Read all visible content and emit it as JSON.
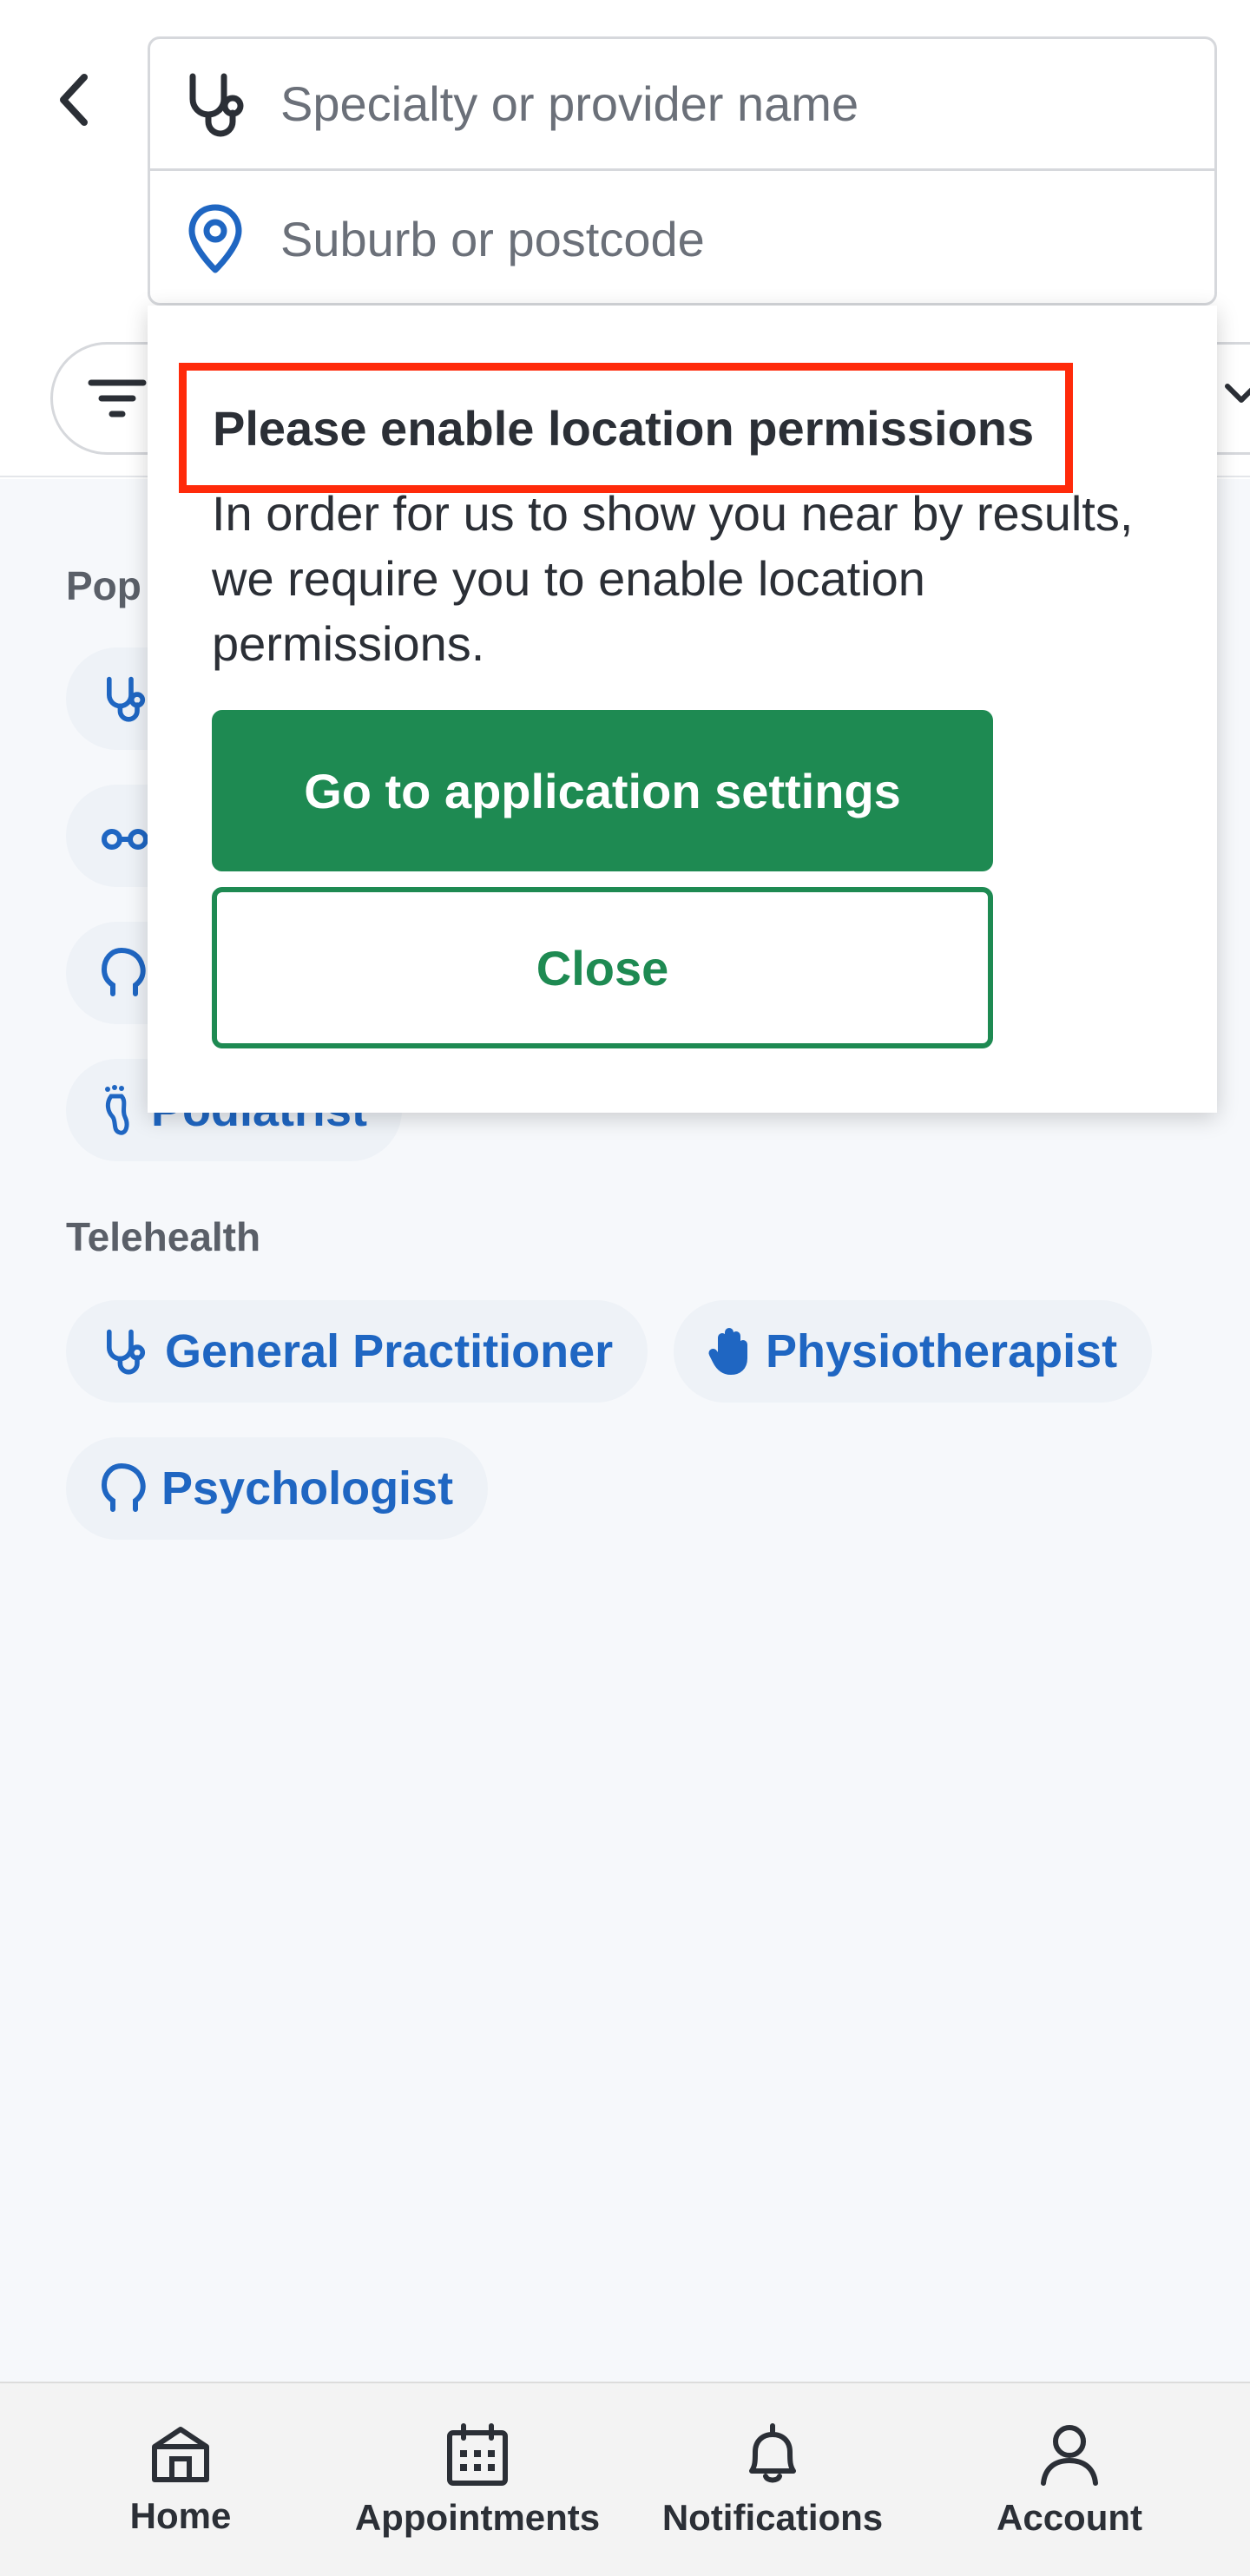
{
  "search": {
    "specialty_placeholder": "Specialty or provider name",
    "location_placeholder": "Suburb or postcode"
  },
  "colors": {
    "accent_blue": "#1f66c2",
    "primary_green": "#1e8a52",
    "highlight_red": "#ff2a0a"
  },
  "popular": {
    "title_visible": "Pop",
    "partial_chip": "Podiatrist"
  },
  "telehealth": {
    "title": "Telehealth",
    "chips": [
      {
        "label": "General Practitioner",
        "icon": "stethoscope-icon"
      },
      {
        "label": "Physiotherapist",
        "icon": "hand-icon"
      },
      {
        "label": "Psychologist",
        "icon": "head-icon"
      }
    ]
  },
  "popup": {
    "title": "Please enable location permissions",
    "body": "In order for us to show you near by results, we require you to enable location permissions.",
    "primary_button": "Go to application settings",
    "secondary_button": "Close"
  },
  "nav": {
    "home": "Home",
    "appointments": "Appointments",
    "notifications": "Notifications",
    "account": "Account"
  }
}
